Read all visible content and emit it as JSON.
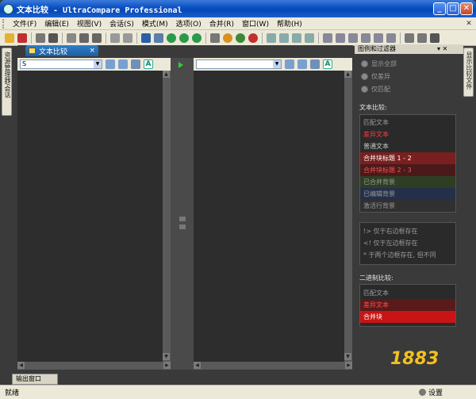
{
  "window": {
    "title": "文本比较 - UltraCompare Professional"
  },
  "menu": [
    "文件(F)",
    "编辑(E)",
    "视图(V)",
    "会话(S)",
    "模式(M)",
    "选项(O)",
    "合并(R)",
    "窗口(W)",
    "帮助(H)"
  ],
  "left_tab": {
    "label": "资源管理器/会话"
  },
  "doc_tab": {
    "label": "文本比较",
    "close": "×"
  },
  "left_pane": {
    "path_value": "S"
  },
  "right_pane": {
    "path_value": ""
  },
  "right_panel": {
    "title": "图例和过滤器",
    "controls": "▾ ✕",
    "radios": [
      "显示全部",
      "仅差异",
      "仅匹配"
    ],
    "text_compare_label": "文本比较:",
    "legend": [
      {
        "text": "匹配文本",
        "fg": "#9a9a9a",
        "bg": "#2a2a2a"
      },
      {
        "text": "差异文本",
        "fg": "#ff3a3a",
        "bg": "#2a2a2a"
      },
      {
        "text": "普通文本",
        "fg": "#c8c8c8",
        "bg": "#2a2a2a"
      },
      {
        "text": "合并块标题 1 - 2",
        "fg": "#ffffff",
        "bg": "#7a1f1f"
      },
      {
        "text": "合并块标题 2 - 3",
        "fg": "#ff5050",
        "bg": "#4a1a1a"
      },
      {
        "text": "已合并背景",
        "fg": "#9a9a9a",
        "bg": "#2e3e24"
      },
      {
        "text": "已编辑背景",
        "fg": "#9a9a9a",
        "bg": "#24304a"
      },
      {
        "text": "激活行背景",
        "fg": "#9a9a9a",
        "bg": "#303030"
      }
    ],
    "markers": [
      "!> 仅于右边框存在",
      "<! 仅于左边框存在",
      "* 于两个边框存在, 但不同"
    ],
    "binary_label": "二进制比较:",
    "binary": [
      {
        "text": "匹配文本",
        "fg": "#9a9a9a",
        "bg": "#2a2a2a"
      },
      {
        "text": "差异文本",
        "fg": "#ff5050",
        "bg": "#5a1a1a"
      },
      {
        "text": "合并块",
        "fg": "#ffffff",
        "bg": "#c81414"
      }
    ]
  },
  "right_tab": {
    "label": "显示比较文件"
  },
  "output_tab": {
    "label": "输出窗口"
  },
  "status": {
    "left": "就绪",
    "right": "设置"
  },
  "watermark": "1883"
}
